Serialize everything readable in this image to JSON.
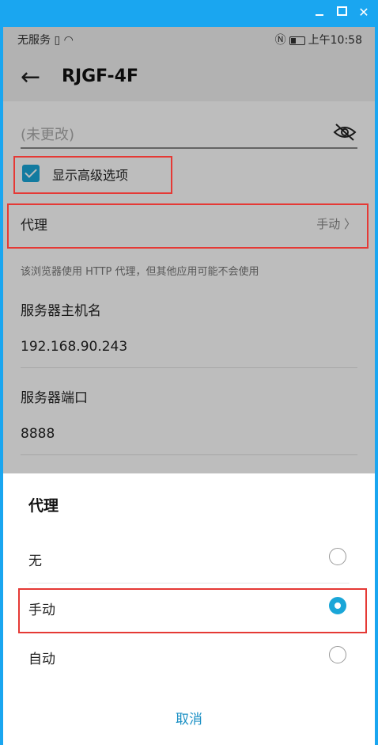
{
  "status_bar": {
    "left_text": "无服务",
    "time": "上午10:58"
  },
  "header": {
    "title": "RJGF-4F"
  },
  "password": {
    "placeholder": "(未更改)"
  },
  "advanced": {
    "label": "显示高级选项",
    "checked": true
  },
  "proxy": {
    "label": "代理",
    "value": "手动"
  },
  "hint": "该浏览器使用 HTTP 代理，但其他应用可能不会使用",
  "host": {
    "label": "服务器主机名",
    "value": "192.168.90.243"
  },
  "port": {
    "label": "服务器端口",
    "value": "8888"
  },
  "dialog": {
    "title": "代理",
    "options": [
      {
        "label": "无",
        "selected": false
      },
      {
        "label": "手动",
        "selected": true
      },
      {
        "label": "自动",
        "selected": false
      }
    ],
    "cancel": "取消"
  },
  "colors": {
    "accent": "#1aa6d8",
    "highlight": "#e53935",
    "window": "#1aa6f0"
  }
}
